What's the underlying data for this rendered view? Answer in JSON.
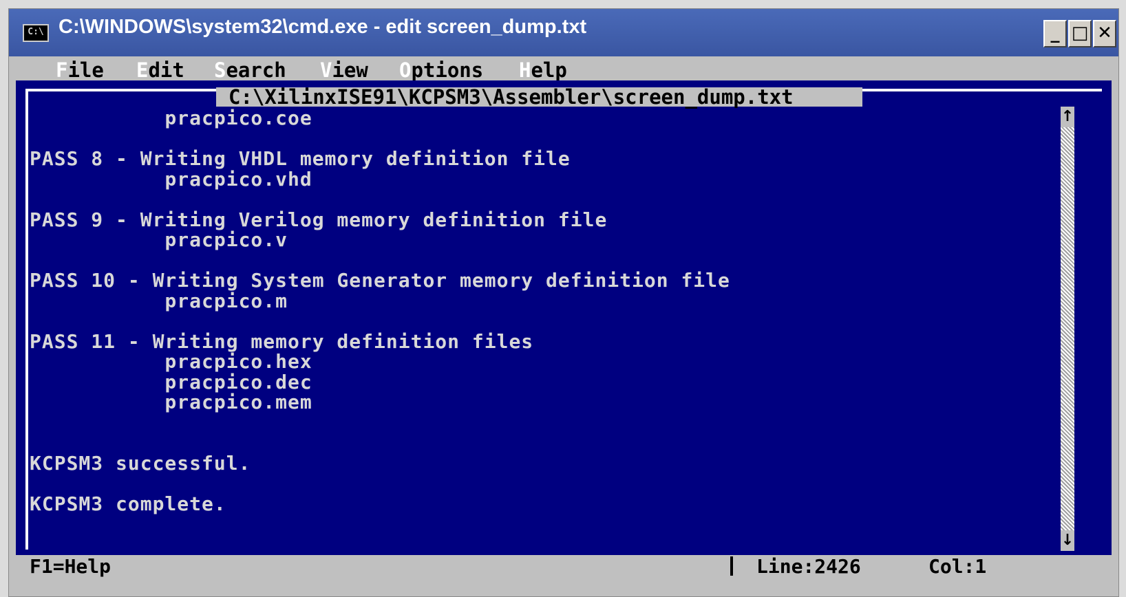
{
  "window": {
    "icon_text": "C:\\",
    "title": "C:\\WINDOWS\\system32\\cmd.exe - edit screen_dump.txt",
    "controls": {
      "minimize": "_",
      "maximize": "□",
      "close": "✕"
    }
  },
  "menu": [
    {
      "hot": "F",
      "rest": "ile"
    },
    {
      "hot": "E",
      "rest": "dit"
    },
    {
      "hot": "S",
      "rest": "earch"
    },
    {
      "hot": "V",
      "rest": "iew"
    },
    {
      "hot": "O",
      "rest": "ptions"
    },
    {
      "hot": "H",
      "rest": "elp"
    }
  ],
  "editor": {
    "file_path": "C:\\XilinxISE91\\KCPSM3\\Assembler\\screen_dump.txt",
    "lines": [
      "           pracpico.coe",
      "",
      "PASS 8 - Writing VHDL memory definition file",
      "           pracpico.vhd",
      "",
      "PASS 9 - Writing Verilog memory definition file",
      "           pracpico.v",
      "",
      "PASS 10 - Writing System Generator memory definition file",
      "           pracpico.m",
      "",
      "PASS 11 - Writing memory definition files",
      "           pracpico.hex",
      "           pracpico.dec",
      "           pracpico.mem",
      "",
      "",
      "KCPSM3 successful.",
      "",
      "KCPSM3 complete."
    ]
  },
  "scrollbar": {
    "up_arrow": "↑",
    "down_arrow": "↓"
  },
  "status": {
    "help": "F1=Help",
    "line": "Line:2426",
    "col": "Col:1"
  }
}
